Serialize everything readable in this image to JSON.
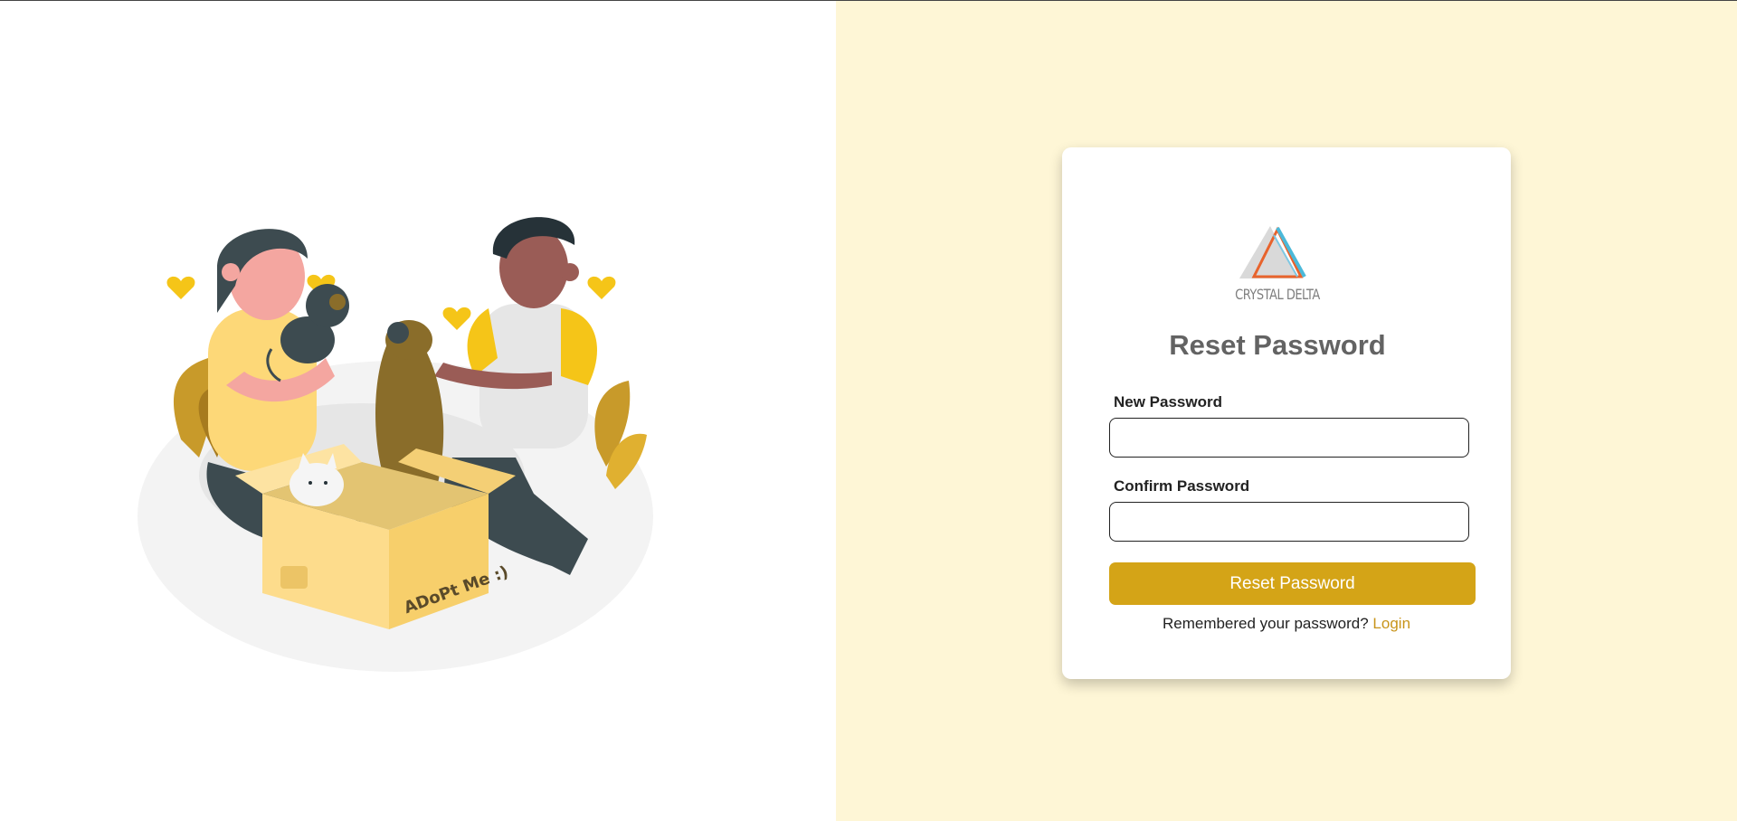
{
  "branding": {
    "logo_text": "CRYSTAL DELTA"
  },
  "illustration": {
    "box_text": "ADoPt Me :)"
  },
  "form": {
    "title": "Reset Password",
    "new_password_label": "New Password",
    "new_password_value": "",
    "confirm_password_label": "Confirm Password",
    "confirm_password_value": "",
    "submit_label": "Reset Password",
    "footer_prompt": "Remembered your password?",
    "login_link": "Login"
  },
  "colors": {
    "right_panel_bg": "#fef6d6",
    "accent": "#d4a417",
    "link": "#c8941a",
    "title": "#636363"
  }
}
